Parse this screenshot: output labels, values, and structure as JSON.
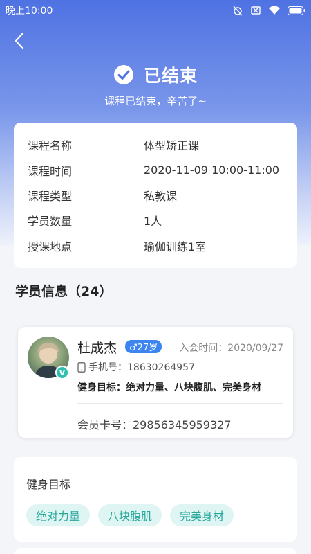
{
  "status_bar": {
    "time": "晚上10:00"
  },
  "header": {
    "state_title": "已结束",
    "state_subtitle": "课程已结束，辛苦了~"
  },
  "course_info": [
    {
      "label": "课程名称",
      "value": "体型矫正课"
    },
    {
      "label": "课程时间",
      "value": "2020-11-09 10:00-11:00"
    },
    {
      "label": "课程类型",
      "value": "私教课"
    },
    {
      "label": "学员数量",
      "value": "1人"
    },
    {
      "label": "授课地点",
      "value": "瑜伽训练1室"
    }
  ],
  "students_section": {
    "title": "学员信息（24）"
  },
  "student": {
    "name": "杜成杰",
    "gender_age": "♂27岁",
    "join_time": "入会时间：2020/09/27",
    "phone": "手机号：18630264957",
    "fitness_goal": "健身目标：绝对力量、八块腹肌、完美身材",
    "member_card": "会员卡号：29856345959327",
    "verified_badge": "V"
  },
  "goals": {
    "title": "健身目标",
    "tags": [
      "绝对力量",
      "八块腹肌",
      "完美身材"
    ]
  },
  "colors": {
    "header_gradient_top": "#4f72e3",
    "accent_blue": "#3c84f0",
    "tag_bg": "#dff5f3",
    "tag_text": "#27a89b"
  }
}
